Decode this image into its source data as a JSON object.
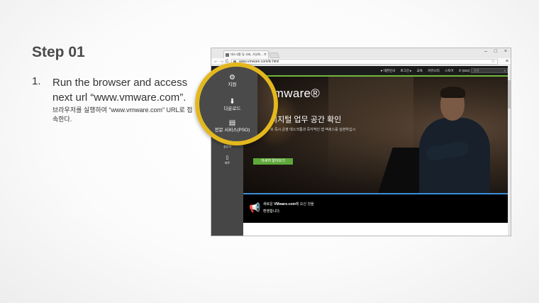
{
  "slide": {
    "title": "Step 01",
    "step_number": "1.",
    "instruction": "Run the browser and access next url “www.vmware.com”.",
    "instruction_ko": "브라우저를 실행하여 “www.vmware.com” URL로 접속한다."
  },
  "browser": {
    "tab_title": "데스크톱 및 서버, 가상화…",
    "tab_close": "×",
    "win_min": "–",
    "win_max": "□",
    "win_close": "×",
    "back": "←",
    "forward": "→",
    "reload": "C",
    "url": "www.vmware.com/kr.html",
    "star": "☆",
    "menu": "≡"
  },
  "site": {
    "nav": [
      "● 대한민국",
      "로그인 ▸",
      "교육",
      "커뮤니티",
      "스토어",
      "✆ (822) 3016-6500"
    ],
    "search_placeholder": "검색",
    "search_icon": "⌕",
    "hero_logo": "vmware®",
    "hero_title": "디지털 업무 공간 확인",
    "hero_sub": "로 즉시 운영 데스크톱과 즉각적인 앱 액세스를 실현하십시",
    "hero_button": "자세히 알아보기",
    "sidebar": [
      {
        "icon": "⚙",
        "label": "지원"
      },
      {
        "icon": "⬇",
        "label": "다운로드"
      },
      {
        "icon": "▤",
        "label": "전문 서비스(PSO)"
      },
      {
        "icon": "•••",
        "label": "실무자"
      },
      {
        "icon": "▯",
        "label": "파트"
      }
    ],
    "promo_line1_pre": "새로운 ",
    "promo_line1_bold": "VMware.com",
    "promo_line1_post": "에 오신 것을",
    "promo_line2": "환영합니다.",
    "promo_icon": "📢"
  },
  "callout": {
    "items": [
      {
        "icon": "⚙",
        "label": "지원"
      },
      {
        "icon": "⬇",
        "label": "다운로드"
      },
      {
        "icon": "▤",
        "label": "전문 서비스(PSO)"
      }
    ]
  },
  "colors": {
    "accent_green": "#72b73d",
    "callout_ring": "#e4b81d",
    "promo_blue": "#3a8fd8"
  }
}
